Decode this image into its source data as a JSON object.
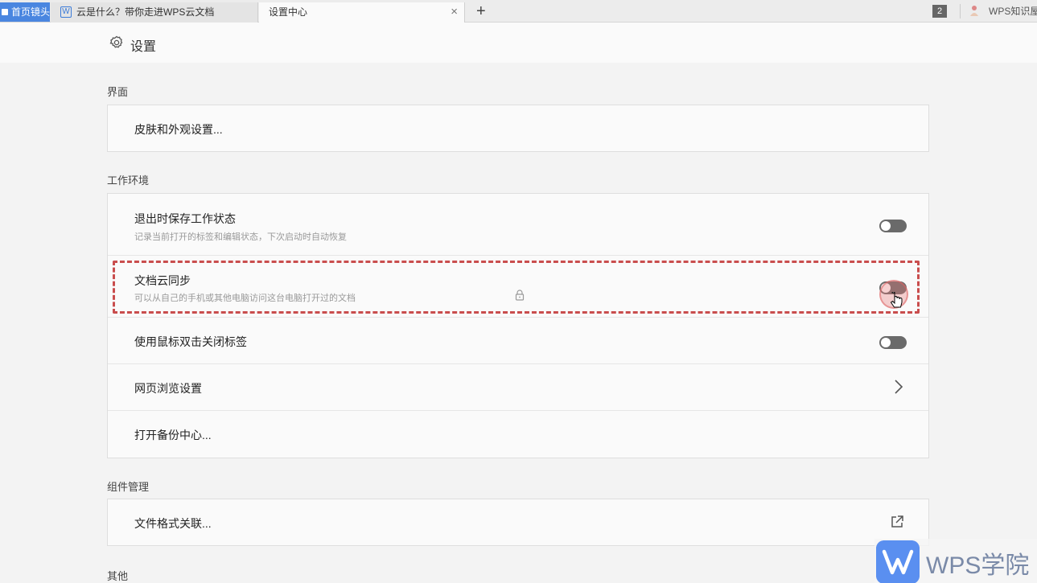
{
  "tabs": {
    "home_label": "首页镜头",
    "doc_tab": "云是什么？带你走进WPS云文档",
    "settings_tab": "设置中心",
    "new_tab": "+",
    "close_glyph": "×",
    "doc_icon_letter": "W",
    "window_count": "2",
    "user_name": "WPS知识屋"
  },
  "header": {
    "title": "设置"
  },
  "sections": {
    "interface": {
      "label": "界面",
      "items": [
        {
          "title": "皮肤和外观设置..."
        }
      ]
    },
    "workspace": {
      "label": "工作环境",
      "items": [
        {
          "title": "退出时保存工作状态",
          "desc": "记录当前打开的标签和编辑状态，下次启动时自动恢复",
          "toggle": "off"
        },
        {
          "title": "文档云同步",
          "desc": "可以从自己的手机或其他电脑访问这台电脑打开过的文档",
          "toggle": "off"
        },
        {
          "title": "使用鼠标双击关闭标签",
          "toggle": "off"
        },
        {
          "title": "网页浏览设置",
          "trailing": "chevron-right-icon"
        },
        {
          "title": "打开备份中心..."
        }
      ]
    },
    "components": {
      "label": "组件管理",
      "items": [
        {
          "title": "文件格式关联...",
          "trailing": "external-link-icon"
        }
      ]
    },
    "other": {
      "label": "其他"
    }
  },
  "watermark": {
    "text": "WPS学院"
  },
  "colors": {
    "accent": "#4a86e0",
    "highlight": "#c94d4d",
    "toggle_off": "#6a6a6a"
  }
}
